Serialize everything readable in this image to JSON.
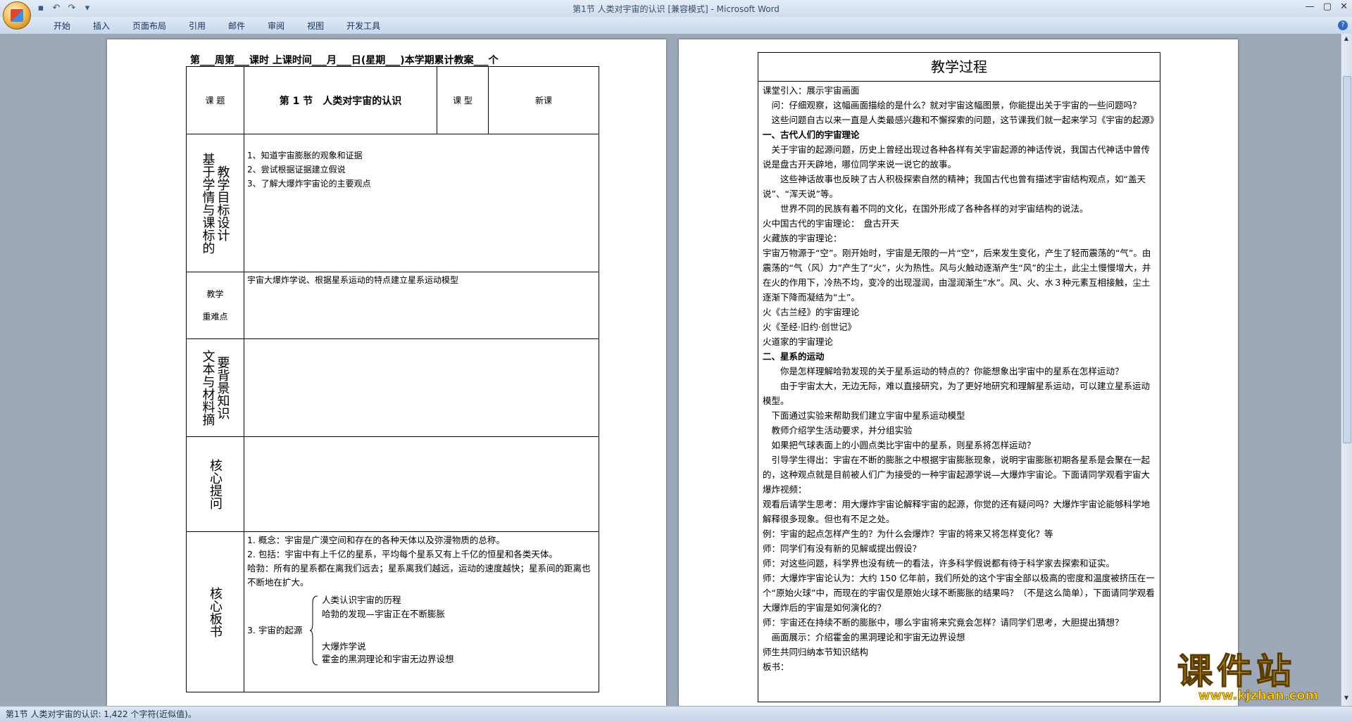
{
  "window": {
    "title": "第1节 人类对宇宙的认识 [兼容模式] - Microsoft Word",
    "controls": [
      "—",
      "▢",
      "✕"
    ]
  },
  "quick_access": [
    "save-icon",
    "undo-icon",
    "redo-icon",
    "customize-icon"
  ],
  "ribbon": {
    "tabs": [
      "开始",
      "插入",
      "页面布局",
      "引用",
      "邮件",
      "审阅",
      "视图",
      "开发工具"
    ],
    "help": "?"
  },
  "page1": {
    "header": "第___周第___课时 上课时间___月___日(星期___)本学期累计教案___个",
    "topic_label": "课 题",
    "topic_value": "第 1 节　人类对宇宙的认识",
    "type_label": "课 型",
    "type_value": "新课",
    "objectives_label": "基于学情与课标的教学目标设计",
    "objectives": [
      "1、知道宇宙膨胀的观象和证据",
      "2、尝试根据证据建立假说",
      "3、了解大爆炸宇宙论的主要观点"
    ],
    "keypoints_label_1": "教学",
    "keypoints_label_2": "重难点",
    "keypoints_value": "宇宙大爆炸学说、根据星系运动的特点建立星系运动模型",
    "materials_label": "文本与材料摘要背景知识",
    "questions_label": "核心提问",
    "board_label": "核心板书",
    "board_lines": [
      "1. 概念：宇宙是广漠空间和存在的各种天体以及弥漫物质的总称。",
      "2. 包括：宇宙中有上千亿的星系，平均每个星系又有上千亿的恒星和各类天体。",
      "哈勃：所有的星系都在离我们远去；星系离我们越远，运动的速度越快；星系间的距离也不断地在扩大。"
    ],
    "board_origin": "3. 宇宙的起源",
    "board_brace_items": [
      "人类认识宇宙的历程",
      "哈勃的发现—宇宙正在不断膨胀",
      "大爆炸学说",
      "霍金的黑洞理论和宇宙无边界设想"
    ]
  },
  "page2": {
    "heading": "教学过程",
    "lines": [
      {
        "t": "课堂引入：展示宇宙画面",
        "b": false
      },
      {
        "t": "　问：仔细观察，这幅画面描绘的是什么？就对宇宙这幅图景，你能提出关于宇宙的一些问题吗？",
        "b": false
      },
      {
        "t": "　这些问题自古以来一直是人类最感兴趣和不懈探索的问题，这节课我们就一起来学习《宇宙的起源》",
        "b": false
      },
      {
        "t": "一、古代人们的宇宙理论",
        "b": true
      },
      {
        "t": "　关于宇宙的起源问题，历史上曾经出现过各种各样有关宇宙起源的神话传说，我国古代神话中曾传说是盘古开天辟地，哪位同学来说一说它的故事。",
        "b": false
      },
      {
        "t": "　　这些神话故事也反映了古人积极探索自然的精神；我国古代也曾有描述宇宙结构观点，如“盖天说”、“浑天说”等。",
        "b": false
      },
      {
        "t": "　　世界不同的民族有着不同的文化，在国外形成了各种各样的对宇宙结构的说法。",
        "b": false
      },
      {
        "t": "火中国古代的宇宙理论：　盘古开天",
        "b": false
      },
      {
        "t": "火藏族的宇宙理论：",
        "b": false
      },
      {
        "t": "宇宙万物源于“空”。刚开始时，宇宙是无限的一片“空”，后来发生变化，产生了轻而震荡的“气”。由震荡的“气（风）力”产生了“火”，火为热性。风与火触动逐渐产生“风”的尘土，此尘土慢慢增大，并在火的作用下，冷热不均，变冷的出现湿润，由湿润渐生“水”。风、火、水３种元素互相接触，尘土逐渐下降而凝结为“土”。",
        "b": false
      },
      {
        "t": "火《古兰经》的宇宙理论",
        "b": false
      },
      {
        "t": "火《圣经·旧约·创世记》",
        "b": false
      },
      {
        "t": "火道家的宇宙理论",
        "b": false
      },
      {
        "t": "二、星系的运动",
        "b": true
      },
      {
        "t": "　　你是怎样理解哈勃发现的关于星系运动的特点的？你能想象出宇宙中的星系在怎样运动？",
        "b": false
      },
      {
        "t": "　　由于宇宙太大，无边无际，难以直接研究，为了更好地研究和理解星系运动，可以建立星系运动模型。",
        "b": false
      },
      {
        "t": "　下面通过实验来帮助我们建立宇宙中星系运动模型",
        "b": false
      },
      {
        "t": "　教师介绍学生活动要求，并分组实验",
        "b": false
      },
      {
        "t": "　如果把气球表面上的小圆点类比宇宙中的星系，则星系将怎样运动？",
        "b": false
      },
      {
        "t": "　引导学生得出：宇宙在不断的膨胀之中根据宇宙膨胀现象，说明宇宙膨胀初期各星系是会聚在一起的，这种观点就是目前被人们广为接受的一种宇宙起源学说—大爆炸宇宙论。下面请同学观看宇宙大爆炸视频：",
        "b": false
      },
      {
        "t": "观看后请学生思考：用大爆炸宇宙论解释宇宙的起源，你觉的还有疑问吗？大爆炸宇宙论能够科学地解释很多现象。但也有不足之处。",
        "b": false
      },
      {
        "t": "例：宇宙的起点怎样产生的？为什么会爆炸？宇宙的将来又将怎样变化？等",
        "b": false
      },
      {
        "t": "师：同学们有没有新的见解或提出假设？",
        "b": false
      },
      {
        "t": "师：对这些问题，科学界也没有统一的看法，许多科学假说都有待于科学家去探索和证实。",
        "b": false
      },
      {
        "t": "师：大爆炸宇宙论认为：大约 150 亿年前，我们所处的这个宇宙全部以极高的密度和温度被挤压在一个“原始火球”中，而现在的宇宙仅是原始火球不断膨胀的结果吗？（不是这么简单），下面请同学观看大爆炸后的宇宙是如何演化的？",
        "b": false
      },
      {
        "t": "师：宇宙还在持续不断的膨胀中，哪么宇宙将来究竟会怎样？请同学们思考，大胆提出猜想？",
        "b": false
      },
      {
        "t": "　画面展示：介绍霍金的黑洞理论和宇宙无边界设想",
        "b": false
      },
      {
        "t": "师生共同归纳本节知识结构",
        "b": false
      },
      {
        "t": "板书：",
        "b": false
      }
    ]
  },
  "status": {
    "text": "第1节 人类对宇宙的认识: 1,422 个字符(近似值)。"
  },
  "watermark": {
    "big": "课件站",
    "small": "www.kjzhan.com"
  }
}
